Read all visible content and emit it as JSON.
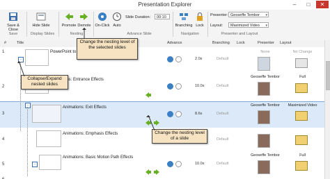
{
  "window": {
    "title": "Presentation Explorer",
    "minimize": "–",
    "maximize": "□",
    "close": "✕"
  },
  "ribbon": {
    "save_close": "Save & Close",
    "hide_slide": "Hide Slide",
    "promote": "Promote",
    "demote": "Demote",
    "on_click": "On-Click",
    "auto": "Auto",
    "slide_duration_label": "Slide Duration:",
    "slide_duration_value": "00:10",
    "branching": "Branching",
    "lock": "Lock",
    "presenter_label": "Presenter:",
    "presenter_value": "Geoseffe Tembor",
    "layout_label": "Layout:",
    "layout_value": "Maximized Video",
    "groups": {
      "save": "Save",
      "display": "Display Slides",
      "nesting": "Nesting",
      "advance": "Advance Slide",
      "navigation": "Navigation",
      "presenter_layout": "Presenter and Layout"
    }
  },
  "columns": {
    "num": "#",
    "title": "Title",
    "advance": "Advance",
    "branching": "Branching",
    "lock": "Lock",
    "presenter": "Presenter",
    "layout": "Layout"
  },
  "rows": [
    {
      "num": "1",
      "title": "PowerPoint to",
      "duration": "2.0s",
      "branching": "Default",
      "presenter": "None",
      "layout": "No Change"
    },
    {
      "num": "2",
      "title": "Animations: Entrance Effects",
      "duration": "10.0s",
      "branching": "Default",
      "presenter": "Geoseffe Tembor",
      "layout": "Full"
    },
    {
      "num": "3",
      "title": "Animations: Exit Effects",
      "duration": "8.6s",
      "branching": "Default",
      "presenter": "Geoseffe Tembor",
      "layout": "Maximized Video"
    },
    {
      "num": "4",
      "title": "Animations: Emphasis Effects",
      "duration": "",
      "branching": "Default",
      "presenter": "",
      "layout": ""
    },
    {
      "num": "5",
      "title": "Animations: Basic Motion Path Effects",
      "duration": "10.0s",
      "branching": "Default",
      "presenter": "Geoseffe Tembor",
      "layout": "Full"
    },
    {
      "num": "6",
      "title": "",
      "duration": "",
      "branching": "",
      "presenter": "",
      "layout": ""
    }
  ],
  "callouts": {
    "nesting_selected": "Change the nesting level of the selected slides",
    "collapse_expand": "Collapse/Expand nested slides",
    "nesting_slide": "Change the nesting level of a slide"
  },
  "colors": {
    "ribbon_bg": "#f4f4f4",
    "selected_row": "#dbe9f8",
    "callout_bg": "#f7e3c2",
    "accent": "#3b7fc4",
    "arrow_green": "#6ab024"
  }
}
